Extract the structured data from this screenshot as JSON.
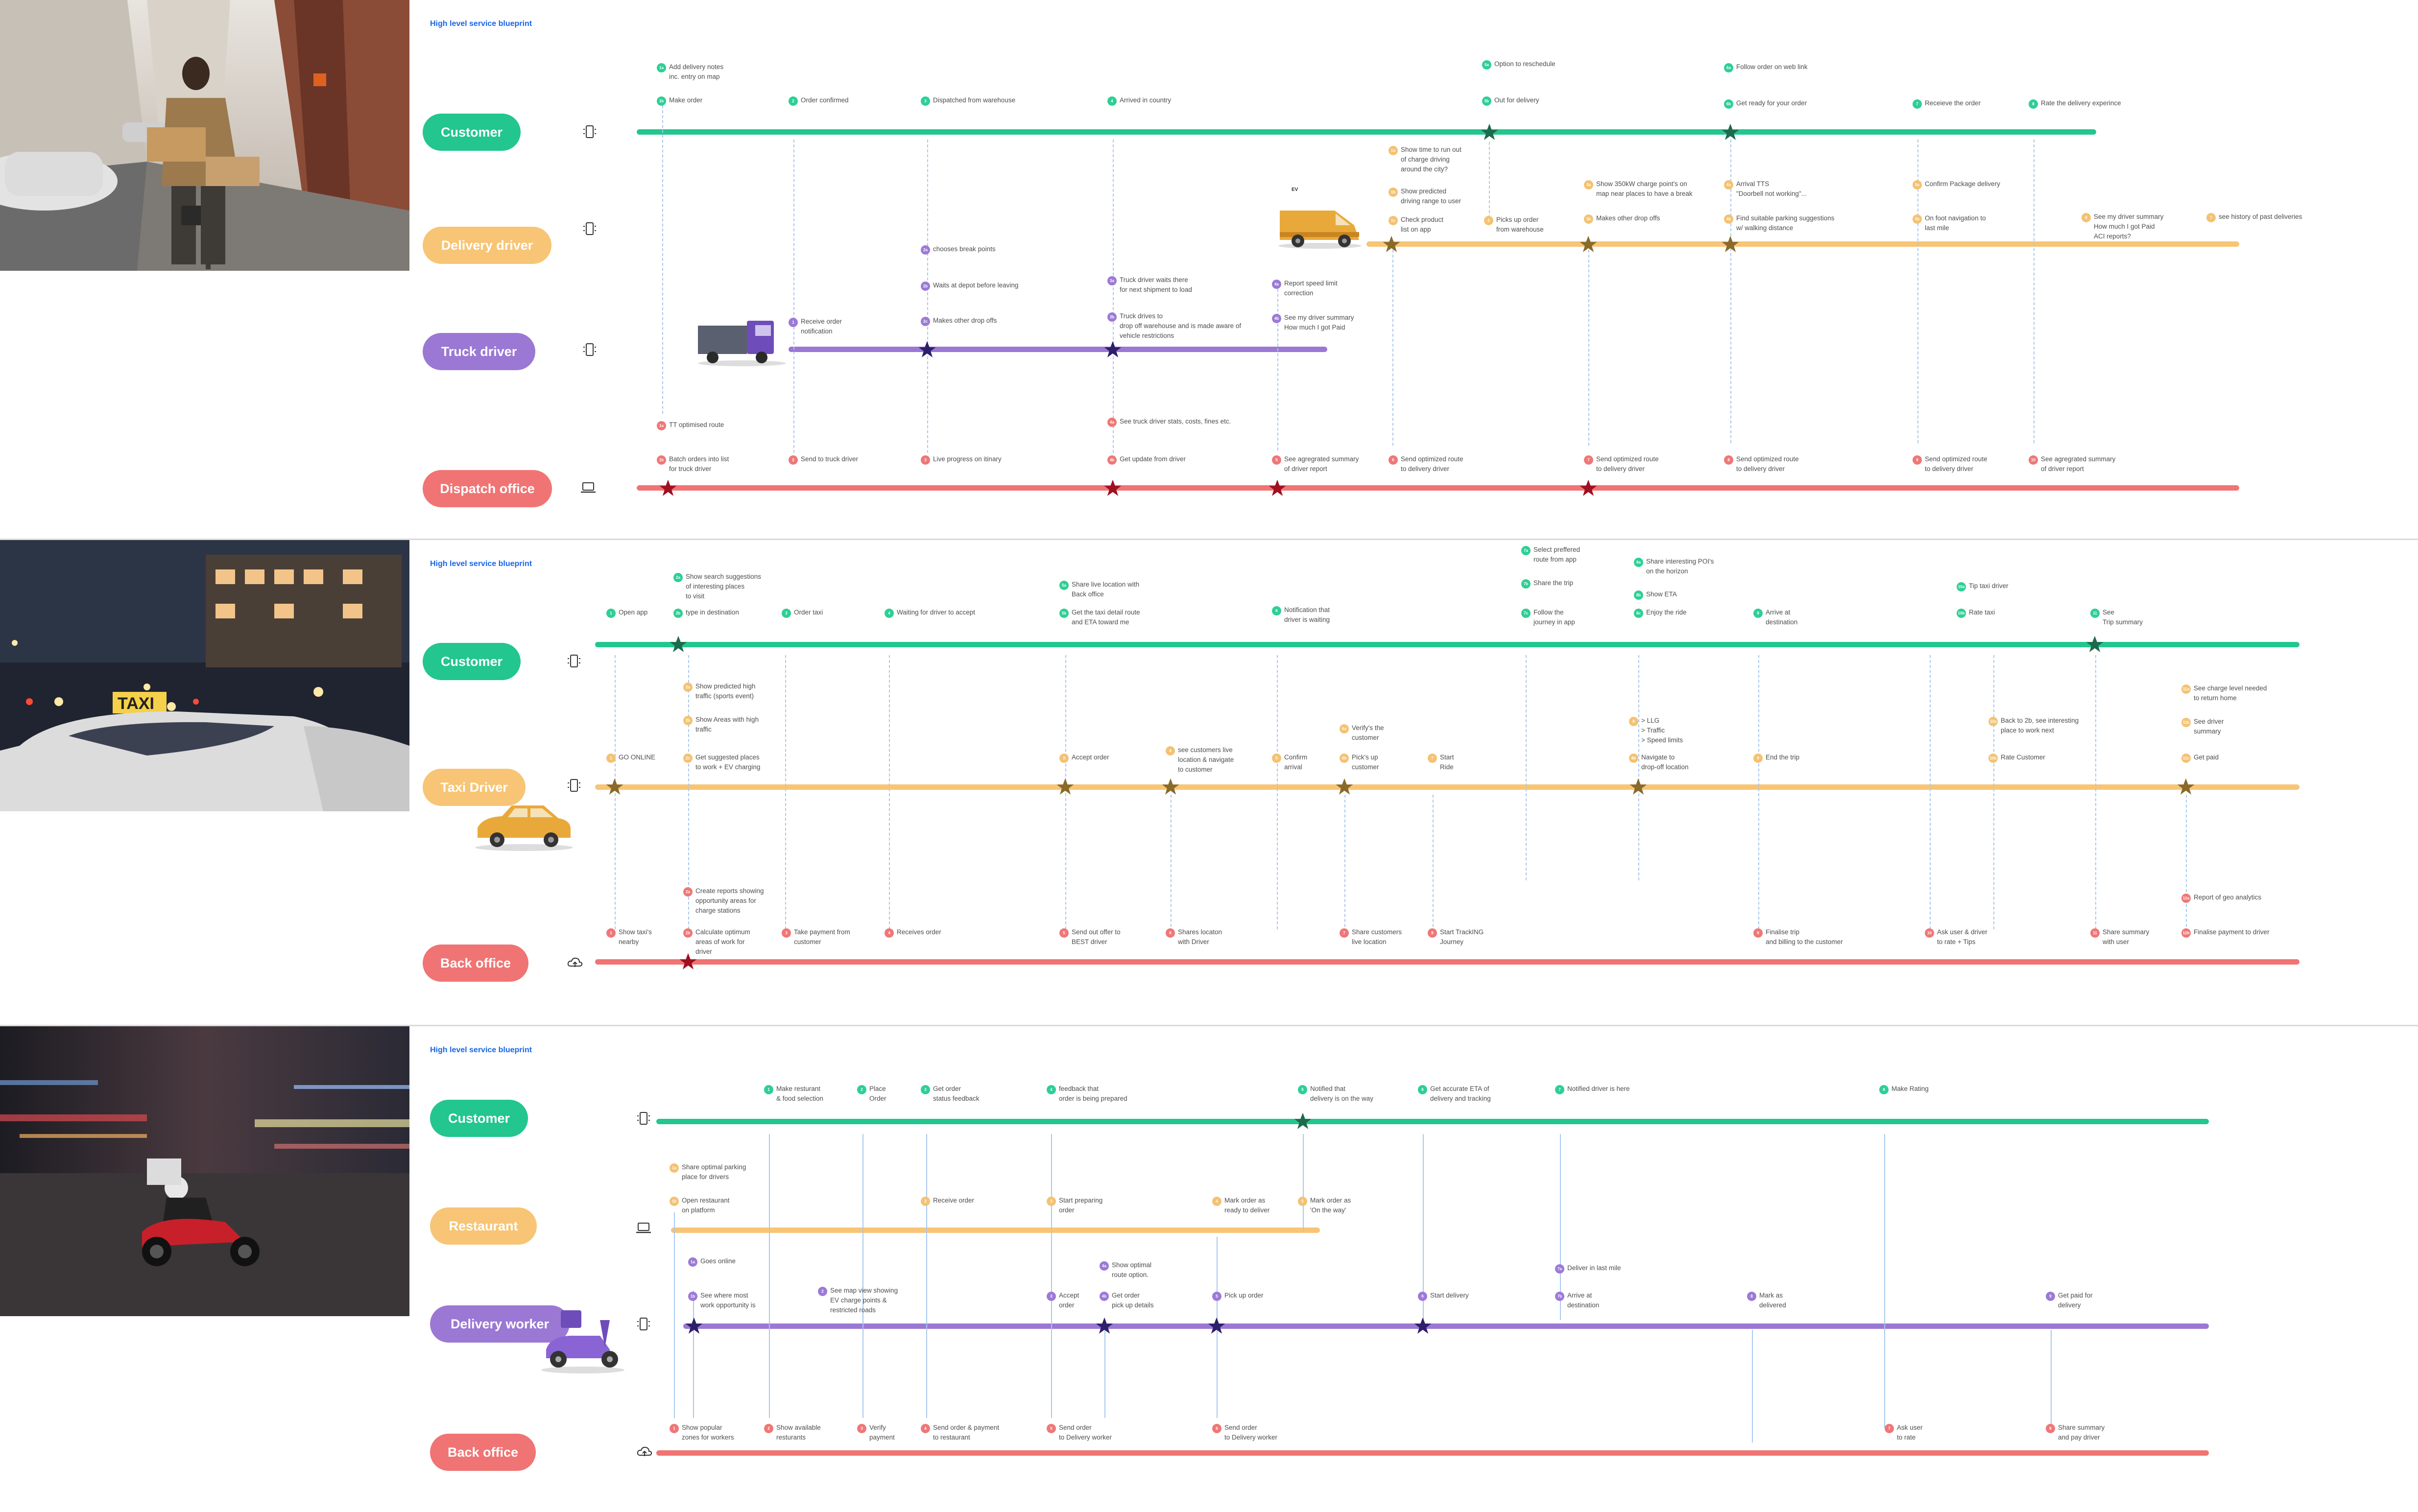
{
  "panels": [
    {
      "title": "High level service blueprint",
      "lanes": [
        {
          "label": "Customer",
          "color": "#22c68e"
        },
        {
          "label": "Delivery driver",
          "color": "#f7c575"
        },
        {
          "label": "Truck driver",
          "color": "#9b78d4"
        },
        {
          "label": "Dispatch office",
          "color": "#f07474"
        }
      ],
      "truck_tag": "EV",
      "steps": [
        {
          "lane": 0,
          "n": "1a",
          "text": "Add delivery notes\ninc. entry on map"
        },
        {
          "lane": 0,
          "n": "1b",
          "text": "Make order"
        },
        {
          "lane": 0,
          "n": "2",
          "text": "Order confirmed"
        },
        {
          "lane": 0,
          "n": "3",
          "text": "Dispatched from warehouse"
        },
        {
          "lane": 0,
          "n": "4",
          "text": "Arrived in country"
        },
        {
          "lane": 0,
          "n": "5a",
          "text": "Option to reschedule"
        },
        {
          "lane": 0,
          "n": "5b",
          "text": "Out for delivery"
        },
        {
          "lane": 0,
          "n": "6a",
          "text": "Follow order on web link"
        },
        {
          "lane": 0,
          "n": "6b",
          "text": "Get ready for your order"
        },
        {
          "lane": 0,
          "n": "7",
          "text": "Receieve the order"
        },
        {
          "lane": 0,
          "n": "8",
          "text": "Rate the delivery experince"
        },
        {
          "lane": 1,
          "n": "1a",
          "text": "Show time to run out\nof charge driving\naround the city?"
        },
        {
          "lane": 1,
          "n": "1b",
          "text": "Show predicted\ndriving range to user"
        },
        {
          "lane": 1,
          "n": "1c",
          "text": "Check product\nlist on app"
        },
        {
          "lane": 1,
          "n": "2",
          "text": "Picks up order\nfrom warehouse"
        },
        {
          "lane": 1,
          "n": "3a",
          "text": "Show 350kW charge point's on\nmap near places to have a break"
        },
        {
          "lane": 1,
          "n": "3b",
          "text": "Makes other drop offs"
        },
        {
          "lane": 1,
          "n": "4a",
          "text": "Arrival TTS\n\"Doorbell not working\"..."
        },
        {
          "lane": 1,
          "n": "4b",
          "text": "Find suitable parking suggestions\nw/ walking distance"
        },
        {
          "lane": 1,
          "n": "5a",
          "text": "Confirm Package delivery"
        },
        {
          "lane": 1,
          "n": "5b",
          "text": "On foot navigation to\nlast mile"
        },
        {
          "lane": 1,
          "n": "6",
          "text": "See my driver summary\nHow much I got Paid\nACI reports?"
        },
        {
          "lane": 1,
          "n": "7",
          "text": "see history of past deliveries"
        },
        {
          "lane": 2,
          "n": "1",
          "text": "Receive order\nnotification"
        },
        {
          "lane": 2,
          "n": "2a",
          "text": "chooses break points"
        },
        {
          "lane": 2,
          "n": "2b",
          "text": "Waits at depot before leaving"
        },
        {
          "lane": 2,
          "n": "2c",
          "text": "Makes other drop offs"
        },
        {
          "lane": 2,
          "n": "3a",
          "text": "Truck driver waits there\nfor next shipment to load"
        },
        {
          "lane": 2,
          "n": "3b",
          "text": "Truck drives to\ndrop off warehouse and is made aware of\nvehicle restrictions"
        },
        {
          "lane": 2,
          "n": "4a",
          "text": "Report speed limit\ncorrection"
        },
        {
          "lane": 2,
          "n": "4b",
          "text": "See my driver summary\nHow much I got Paid"
        },
        {
          "lane": 3,
          "n": "1a",
          "text": "TT optimised route"
        },
        {
          "lane": 3,
          "n": "1b",
          "text": "Batch orders into list\nfor truck driver"
        },
        {
          "lane": 3,
          "n": "2",
          "text": "Send to truck driver"
        },
        {
          "lane": 3,
          "n": "3",
          "text": "Live progress on itinary"
        },
        {
          "lane": 3,
          "n": "4a",
          "text": "See truck driver stats, costs, fines etc."
        },
        {
          "lane": 3,
          "n": "4b",
          "text": "Get update from driver"
        },
        {
          "lane": 3,
          "n": "5",
          "text": "See agregrated summary\nof driver report"
        },
        {
          "lane": 3,
          "n": "6",
          "text": "Send optimized route\nto delivery driver"
        },
        {
          "lane": 3,
          "n": "7",
          "text": "Send optimized route\nto delivery driver"
        },
        {
          "lane": 3,
          "n": "8",
          "text": "Send optimized route\nto delivery driver"
        },
        {
          "lane": 3,
          "n": "9",
          "text": "Send optimized route\nto delivery driver"
        },
        {
          "lane": 3,
          "n": "10",
          "text": "See agregrated summary\nof driver report"
        }
      ]
    },
    {
      "title": "High level service blueprint",
      "lanes": [
        {
          "label": "Customer",
          "color": "#22c68e"
        },
        {
          "label": "Taxi Driver",
          "color": "#f7c575"
        },
        {
          "label": "Back office",
          "color": "#f07474"
        }
      ],
      "taxi_sign": "TAXI",
      "steps": [
        {
          "lane": 0,
          "n": "1",
          "text": "Open app"
        },
        {
          "lane": 0,
          "n": "2a",
          "text": "Show search suggestions\nof interesting places\nto visit"
        },
        {
          "lane": 0,
          "n": "2b",
          "text": "type in destination"
        },
        {
          "lane": 0,
          "n": "3",
          "text": "Order taxi"
        },
        {
          "lane": 0,
          "n": "4",
          "text": "Waiting for driver to accept"
        },
        {
          "lane": 0,
          "n": "5a",
          "text": "Share live location with\nBack office"
        },
        {
          "lane": 0,
          "n": "5b",
          "text": "Get the taxi detail route\nand ETA toward me"
        },
        {
          "lane": 0,
          "n": "6",
          "text": "Notification that\ndriver is waiting"
        },
        {
          "lane": 0,
          "n": "7a",
          "text": "Select preffered\nroute from app"
        },
        {
          "lane": 0,
          "n": "7b",
          "text": "Share the trip"
        },
        {
          "lane": 0,
          "n": "7c",
          "text": "Follow the\njourney in app"
        },
        {
          "lane": 0,
          "n": "8a",
          "text": "Share interesting POI's\non the horizon"
        },
        {
          "lane": 0,
          "n": "8b",
          "text": "Show ETA"
        },
        {
          "lane": 0,
          "n": "8c",
          "text": "Enjoy the ride"
        },
        {
          "lane": 0,
          "n": "9",
          "text": "Arrive at\ndestination"
        },
        {
          "lane": 0,
          "n": "10a",
          "text": "Tip taxi driver"
        },
        {
          "lane": 0,
          "n": "10b",
          "text": "Rate taxi"
        },
        {
          "lane": 0,
          "n": "11",
          "text": "See\nTrip summary"
        },
        {
          "lane": 1,
          "n": "1",
          "text": "GO ONLINE"
        },
        {
          "lane": 1,
          "n": "2a",
          "text": "Show predicted high\ntraffic (sports event)"
        },
        {
          "lane": 1,
          "n": "2b",
          "text": "Show Areas with high\ntraffic"
        },
        {
          "lane": 1,
          "n": "2c",
          "text": "Get suggested places\nto work + EV charging"
        },
        {
          "lane": 1,
          "n": "3",
          "text": "Accept order"
        },
        {
          "lane": 1,
          "n": "4",
          "text": "see customers live\nlocation & navigate\nto customer"
        },
        {
          "lane": 1,
          "n": "5",
          "text": "Confirm\narrival"
        },
        {
          "lane": 1,
          "n": "6a",
          "text": "Verify's the\ncustomer"
        },
        {
          "lane": 1,
          "n": "6b",
          "text": "Pick's up\ncustomer"
        },
        {
          "lane": 1,
          "n": "7",
          "text": "Start\nRide"
        },
        {
          "lane": 1,
          "n": "8",
          "text": "> LLG\n> Traffic\n> Speed limits"
        },
        {
          "lane": 1,
          "n": "8b",
          "text": "Navigate to\ndrop-off location"
        },
        {
          "lane": 1,
          "n": "9",
          "text": "End the trip"
        },
        {
          "lane": 1,
          "n": "10a",
          "text": "Back to 2b, see interesting\nplace to work next"
        },
        {
          "lane": 1,
          "n": "10b",
          "text": "Rate Customer"
        },
        {
          "lane": 1,
          "n": "11a",
          "text": "See charge level needed\nto return home"
        },
        {
          "lane": 1,
          "n": "11b",
          "text": "See driver\nsummary"
        },
        {
          "lane": 1,
          "n": "11c",
          "text": "Get paid"
        },
        {
          "lane": 2,
          "n": "1",
          "text": "Show taxi's\nnearby"
        },
        {
          "lane": 2,
          "n": "2a",
          "text": "Create reports showing\nopportunity areas for\ncharge stations"
        },
        {
          "lane": 2,
          "n": "2b",
          "text": "Calculate optimum\nareas of work for\ndriver"
        },
        {
          "lane": 2,
          "n": "3",
          "text": "Take payment from\ncustomer"
        },
        {
          "lane": 2,
          "n": "4",
          "text": "Receives order"
        },
        {
          "lane": 2,
          "n": "5",
          "text": "Send out offer to\nBEST driver"
        },
        {
          "lane": 2,
          "n": "6",
          "text": "Shares locaton\nwith Driver"
        },
        {
          "lane": 2,
          "n": "7",
          "text": "Share customers\nlive location"
        },
        {
          "lane": 2,
          "n": "8",
          "text": "Start TrackING\nJourney"
        },
        {
          "lane": 2,
          "n": "9",
          "text": "Finalise trip\nand billing to the customer"
        },
        {
          "lane": 2,
          "n": "10",
          "text": "Ask user & driver\nto rate + Tips"
        },
        {
          "lane": 2,
          "n": "11",
          "text": "Share summary\nwith user"
        },
        {
          "lane": 2,
          "n": "12a",
          "text": "Report of geo analytics"
        },
        {
          "lane": 2,
          "n": "12b",
          "text": "Finalise payment to driver"
        }
      ]
    },
    {
      "title": "High level service blueprint",
      "lanes": [
        {
          "label": "Customer",
          "color": "#22c68e"
        },
        {
          "label": "Restaurant",
          "color": "#f7c575"
        },
        {
          "label": "Delivery worker",
          "color": "#9b78d4"
        },
        {
          "label": "Back office",
          "color": "#f07474"
        }
      ],
      "steps": [
        {
          "lane": 0,
          "n": "1",
          "text": "Make resturant\n& food selection"
        },
        {
          "lane": 0,
          "n": "2",
          "text": "Place\nOrder"
        },
        {
          "lane": 0,
          "n": "3",
          "text": "Get order\nstatus feedback"
        },
        {
          "lane": 0,
          "n": "4",
          "text": "feedback that\norder is being prepared"
        },
        {
          "lane": 0,
          "n": "5",
          "text": "Notified that\ndelivery is on the way"
        },
        {
          "lane": 0,
          "n": "6",
          "text": "Get accurate ETA of\ndelivery and tracking"
        },
        {
          "lane": 0,
          "n": "7",
          "text": "Notified driver is here"
        },
        {
          "lane": 0,
          "n": "8",
          "text": "Make Rating"
        },
        {
          "lane": 1,
          "n": "1a",
          "text": "Share optimal parking\nplace for drivers"
        },
        {
          "lane": 1,
          "n": "1b",
          "text": "Open restaurant\non platform"
        },
        {
          "lane": 1,
          "n": "2",
          "text": "Receive order"
        },
        {
          "lane": 1,
          "n": "3",
          "text": "Start preparing\norder"
        },
        {
          "lane": 1,
          "n": "4",
          "text": "Mark order as\nready to deliver"
        },
        {
          "lane": 1,
          "n": "5",
          "text": "Mark order as\n'On the way'"
        },
        {
          "lane": 2,
          "n": "1a",
          "text": "Goes online"
        },
        {
          "lane": 2,
          "n": "1b",
          "text": "See where most\nwork opportunity is"
        },
        {
          "lane": 2,
          "n": "2",
          "text": "See map view showing\nEV charge points &\nrestricted roads"
        },
        {
          "lane": 2,
          "n": "3",
          "text": "Accept\norder"
        },
        {
          "lane": 2,
          "n": "4a",
          "text": "Show optimal\nroute option."
        },
        {
          "lane": 2,
          "n": "4b",
          "text": "Get order\npick up details"
        },
        {
          "lane": 2,
          "n": "5",
          "text": "Pick up order"
        },
        {
          "lane": 2,
          "n": "6",
          "text": "Start delivery"
        },
        {
          "lane": 2,
          "n": "7a",
          "text": "Deliver in last mile"
        },
        {
          "lane": 2,
          "n": "7b",
          "text": "Arrive at\ndestination"
        },
        {
          "lane": 2,
          "n": "8",
          "text": "Mark as\ndelivered"
        },
        {
          "lane": 2,
          "n": "9",
          "text": "Get paid for\ndelivery"
        },
        {
          "lane": 3,
          "n": "1",
          "text": "Show popular\nzones for workers"
        },
        {
          "lane": 3,
          "n": "2",
          "text": "Show available\nresturants"
        },
        {
          "lane": 3,
          "n": "3",
          "text": "Verify\npayment"
        },
        {
          "lane": 3,
          "n": "4",
          "text": "Send order & payment\nto restaurant"
        },
        {
          "lane": 3,
          "n": "5",
          "text": "Send order\nto Delivery worker"
        },
        {
          "lane": 3,
          "n": "6",
          "text": "Send order\nto Delivery worker"
        },
        {
          "lane": 3,
          "n": "7",
          "text": "Ask user\nto rate"
        },
        {
          "lane": 3,
          "n": "8",
          "text": "Share summary\nand pay driver"
        }
      ]
    }
  ]
}
